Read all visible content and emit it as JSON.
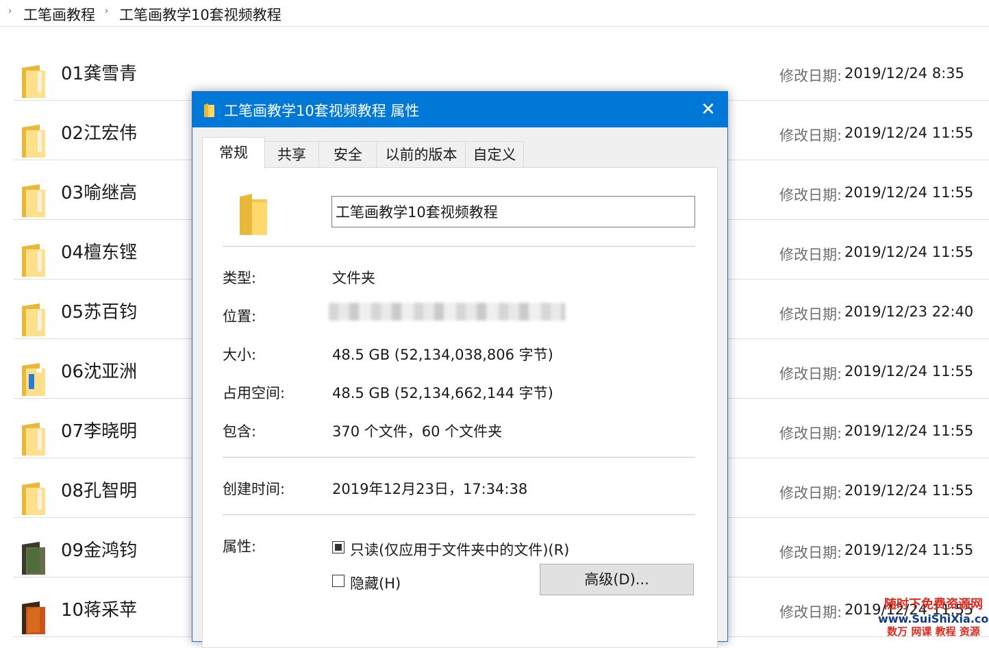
{
  "breadcrumb": [
    "工笔画教程",
    "工笔画教学10套视频教程"
  ],
  "folders": [
    {
      "name": "01龚雪青",
      "modified_label": "修改日期:",
      "modified": "2019/12/24 8:35",
      "style": "plain"
    },
    {
      "name": "02江宏伟",
      "modified_label": "修改日期:",
      "modified": "2019/12/24 11:55",
      "style": "plain"
    },
    {
      "name": "03喻继高",
      "modified_label": "修改日期:",
      "modified": "2019/12/24 11:55",
      "style": "plain"
    },
    {
      "name": "04檀东铿",
      "modified_label": "修改日期:",
      "modified": "2019/12/24 11:55",
      "style": "plain"
    },
    {
      "name": "05苏百钧",
      "modified_label": "修改日期:",
      "modified": "2019/12/23 22:40",
      "style": "plain"
    },
    {
      "name": "06沈亚洲",
      "modified_label": "修改日期:",
      "modified": "2019/12/24 11:55",
      "style": "blue"
    },
    {
      "name": "07李晓明",
      "modified_label": "修改日期:",
      "modified": "2019/12/24 11:55",
      "style": "plain"
    },
    {
      "name": "08孔智明",
      "modified_label": "修改日期:",
      "modified": "2019/12/24 11:55",
      "style": "plain"
    },
    {
      "name": "09金鸿钧",
      "modified_label": "修改日期:",
      "modified": "2019/12/24 11:55",
      "style": "dark"
    },
    {
      "name": "10蒋采苹",
      "modified_label": "修改日期:",
      "modified": "2019/12/24 11:55",
      "style": "orange"
    }
  ],
  "dialog": {
    "title": "工笔画教学10套视频教程 属性",
    "close_glyph": "✕",
    "tabs": [
      "常规",
      "共享",
      "安全",
      "以前的版本",
      "自定义"
    ],
    "active_tab": "常规",
    "folder_name": "工笔画教学10套视频教程",
    "properties": {
      "type_label": "类型:",
      "type_value": "文件夹",
      "location_label": "位置:",
      "size_label": "大小:",
      "size_value": "48.5 GB (52,134,038,806 字节)",
      "disk_label": "占用空间:",
      "disk_value": "48.5 GB (52,134,662,144 字节)",
      "contains_label": "包含:",
      "contains_value": "370 个文件，60 个文件夹",
      "created_label": "创建时间:",
      "created_value": "2019年12月23日，17:34:38",
      "attributes_label": "属性:"
    },
    "readonly": {
      "label": "只读(仅应用于文件夹中的文件)(R)",
      "state": "indeterminate"
    },
    "hidden": {
      "label": "隐藏(H)",
      "checked": false
    },
    "advanced_button": "高级(D)..."
  },
  "watermark": {
    "line1": "随时下免费资源网",
    "line2": "www.SuiShiXia.com",
    "line3": "数万 网课 教程 资源"
  },
  "colors": {
    "titlebar": "#0078d7",
    "folder": "#f6d777",
    "watermark_red": "#e02a1c",
    "watermark_blue": "#0f3a8a"
  }
}
